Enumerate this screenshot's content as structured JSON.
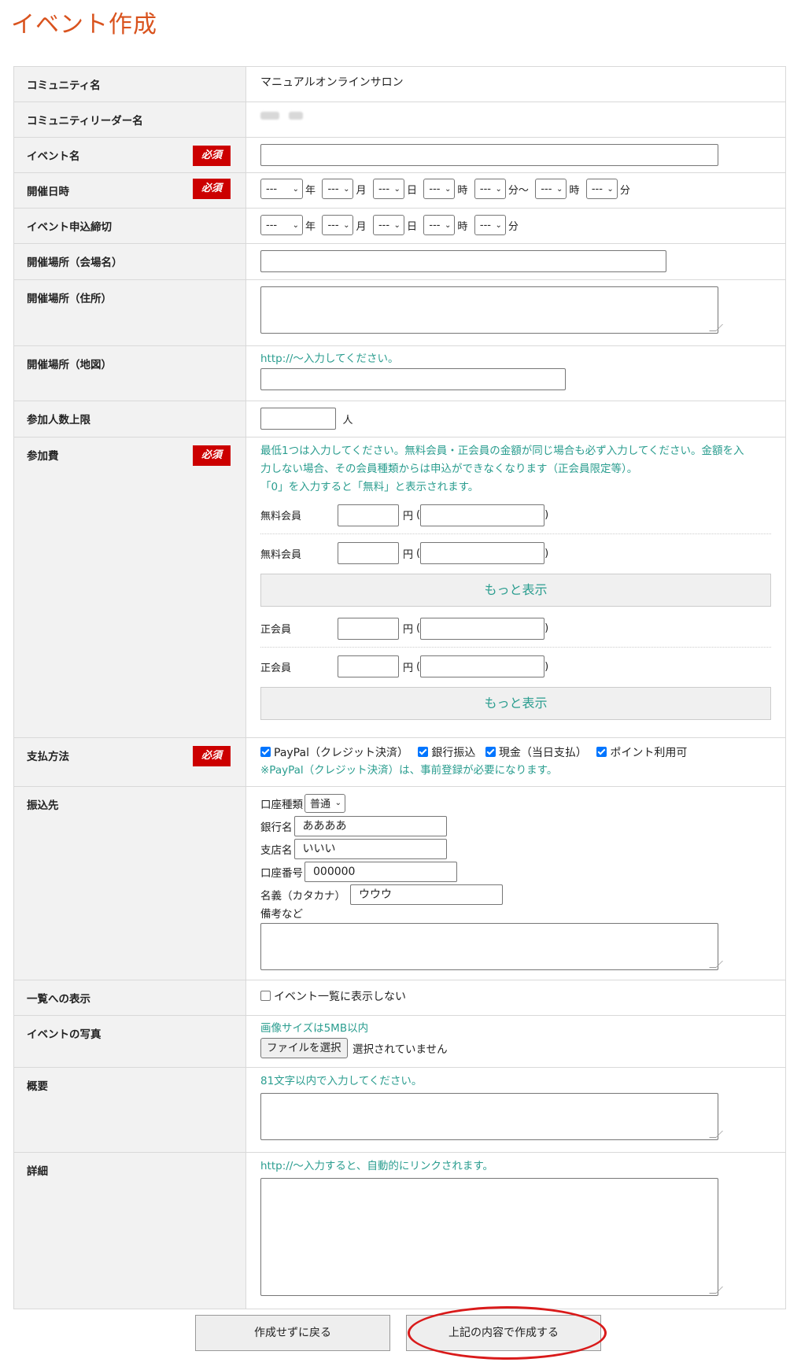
{
  "page_title": "イベント作成",
  "required_badge": "必須",
  "rows": {
    "community_name": {
      "label": "コミュニティ名",
      "value": "マニュアルオンラインサロン"
    },
    "leader_name": {
      "label": "コミュニティリーダー名"
    },
    "event_name": {
      "label": "イベント名",
      "value": ""
    },
    "date": {
      "label": "開催日時",
      "select_value": "---",
      "units": [
        "年",
        "月",
        "日",
        "時",
        "分〜",
        "時",
        "分"
      ]
    },
    "deadline": {
      "label": "イベント申込締切",
      "select_value": "---",
      "units": [
        "年",
        "月",
        "日",
        "時",
        "分"
      ]
    },
    "venue_name": {
      "label": "開催場所（会場名）",
      "value": ""
    },
    "venue_address": {
      "label": "開催場所（住所）",
      "value": ""
    },
    "venue_map": {
      "label": "開催場所（地図）",
      "note": "http://〜入力してください。",
      "value": ""
    },
    "capacity": {
      "label": "参加人数上限",
      "unit": "人",
      "value": ""
    },
    "fee": {
      "label": "参加費",
      "note_lines": [
        "最低1つは入力してください。無料会員・正会員の金額が同じ場合も必ず入力してください。金額を入",
        "力しない場合、その会員種類からは申込ができなくなります（正会員限定等）。",
        "「0」を入力すると「無料」と表示されます。"
      ],
      "yen": "円",
      "paren_open": "(",
      "paren_close": ")",
      "free_member": "無料会員",
      "regular_member": "正会員",
      "more": "もっと表示"
    },
    "payment": {
      "label": "支払方法",
      "options": [
        {
          "label": "PayPal（クレジット決済）",
          "checked": true
        },
        {
          "label": "銀行振込",
          "checked": true
        },
        {
          "label": "現金（当日支払）",
          "checked": true
        },
        {
          "label": "ポイント利用可",
          "checked": true
        }
      ],
      "note": "※PayPal（クレジット決済）は、事前登録が必要になります。"
    },
    "transfer": {
      "label": "振込先",
      "account_type_label": "口座種類",
      "account_type_value": "普通",
      "bank_name_label": "銀行名",
      "bank_name_value": "ああああ",
      "branch_label": "支店名",
      "branch_value": "いいい",
      "account_number_label": "口座番号",
      "account_number_value": "000000",
      "holder_label": "名義（カタカナ）",
      "holder_value": "ウウウ",
      "remarks_label": "備考など"
    },
    "list_display": {
      "label": "一覧への表示",
      "checkbox_label": "イベント一覧に表示しない",
      "checked": false
    },
    "photo": {
      "label": "イベントの写真",
      "note": "画像サイズは5MB以内",
      "button": "ファイルを選択",
      "status": "選択されていません"
    },
    "summary": {
      "label": "概要",
      "note": "81文字以内で入力してください。"
    },
    "detail": {
      "label": "詳細",
      "note": "http://〜入力すると、自動的にリンクされます。"
    }
  },
  "buttons": {
    "back": "作成せずに戻る",
    "create": "上記の内容で作成する"
  },
  "colors": {
    "title": "#d9531e",
    "required": "#cc0000",
    "note": "#2a9d8f",
    "highlight_circle": "#d91a1a"
  }
}
